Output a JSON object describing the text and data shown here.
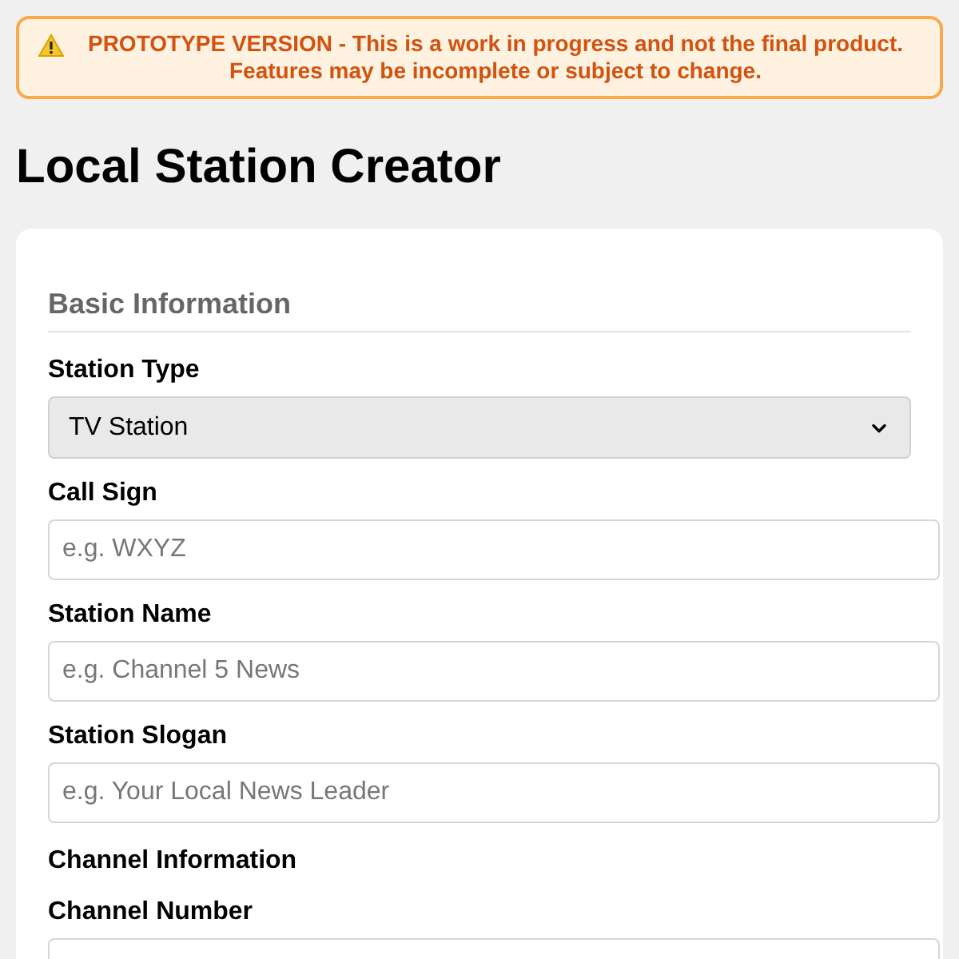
{
  "banner": {
    "text": "PROTOTYPE VERSION - This is a work in progress and not the final product. Features may be incomplete or subject to change."
  },
  "title": "Local Station Creator",
  "section": {
    "heading": "Basic Information"
  },
  "fields": [
    {
      "kind": "select",
      "label": "Station Type",
      "value": "TV Station"
    },
    {
      "kind": "text",
      "label": "Call Sign",
      "placeholder": "e.g. WXYZ"
    },
    {
      "kind": "text",
      "label": "Station Name",
      "placeholder": "e.g. Channel 5 News"
    },
    {
      "kind": "text",
      "label": "Station Slogan",
      "placeholder": "e.g. Your Local News Leader"
    },
    {
      "kind": "subheading",
      "label": "Channel Information"
    },
    {
      "kind": "text",
      "label": "Channel Number"
    }
  ]
}
